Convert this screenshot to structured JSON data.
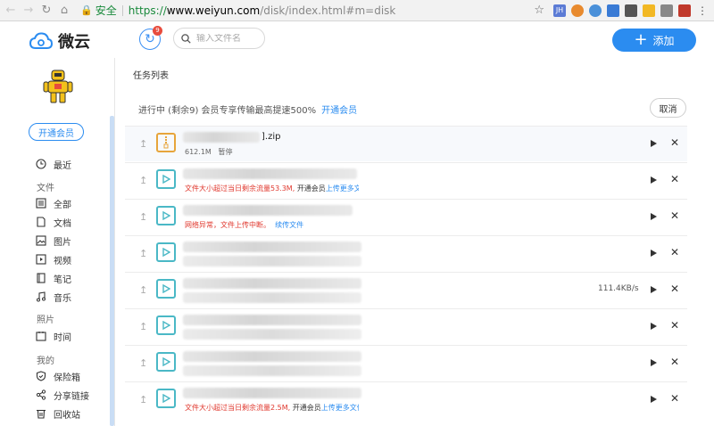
{
  "browser": {
    "secure_label": "安全",
    "url_scheme": "https://",
    "url_host": "www.weiyun.com",
    "url_path": "/disk/index.html#m=disk"
  },
  "header": {
    "app_name": "微云",
    "sync_badge": "9",
    "search_placeholder": "输入文件名",
    "add_label": "添加",
    "accent_color": "#2b8cf0"
  },
  "sidebar": {
    "vip_button": "开通会员",
    "recent": "最近",
    "section_files": "文件",
    "files": [
      "全部",
      "文档",
      "图片",
      "视频",
      "笔记",
      "音乐"
    ],
    "section_photos": "照片",
    "photos": [
      "时间"
    ],
    "section_mine": "我的",
    "mine": [
      "保险箱",
      "分享链接",
      "回收站"
    ]
  },
  "main": {
    "list_title": "任务列表",
    "status_text": "进行中 (剩余9) 会员专享传输最高提速500%",
    "status_vip_link": "开通会员",
    "cancel_label": "取消",
    "rows": [
      {
        "type": "zip",
        "name_ext": "].zip",
        "size": "612.1M",
        "state": "暂停"
      },
      {
        "type": "video",
        "err_red": "文件大小超过当日剩余流量53.3M,",
        "err_dark": "开通会员",
        "err_blue": "上传更多文"
      },
      {
        "type": "video",
        "err_red": "网络异常，文件上传中断。",
        "err_blue": "续传文件"
      },
      {
        "type": "video"
      },
      {
        "type": "video",
        "speed": "111.4KB/s"
      },
      {
        "type": "video"
      },
      {
        "type": "video"
      },
      {
        "type": "video",
        "err_red": "文件大小超过当日剩余流量2.5M,",
        "err_dark": "开通会员",
        "err_blue": "上传更多文件"
      }
    ]
  }
}
